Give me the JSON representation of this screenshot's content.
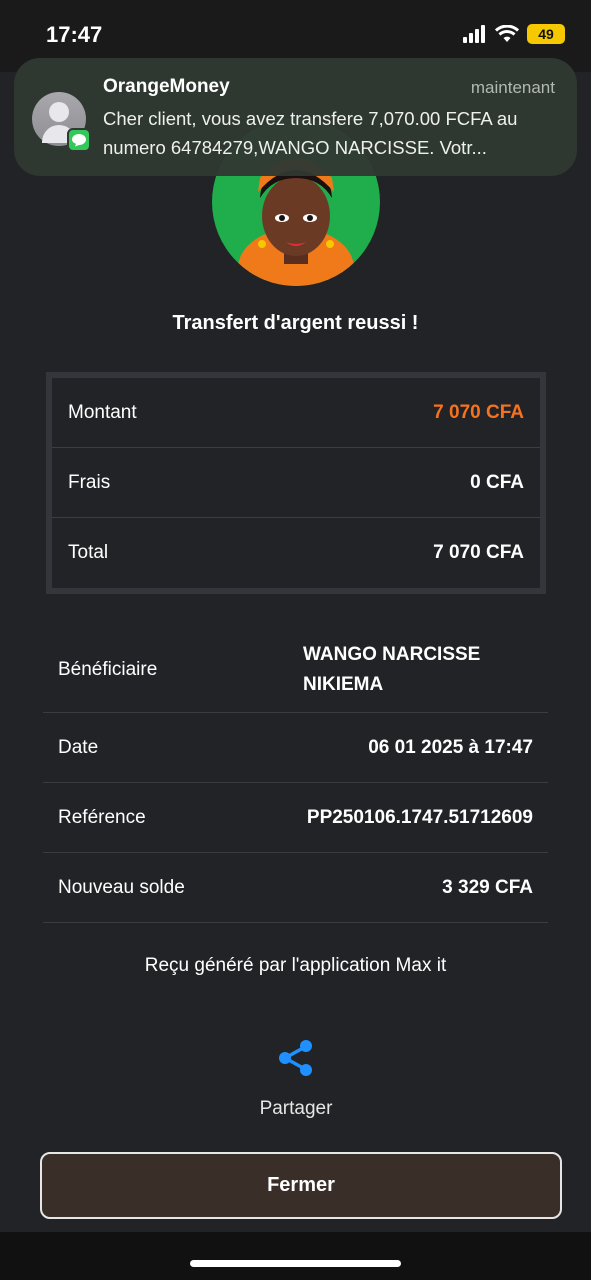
{
  "status": {
    "time": "17:47",
    "battery": "49"
  },
  "notification": {
    "app_name": "OrangeMoney",
    "time": "maintenant",
    "message": "Cher client, vous avez transfere 7,070.00 FCFA au numero 64784279,WANGO NARCISSE. Votr..."
  },
  "title": "Transfert d'argent reussi !",
  "summary": {
    "amount_label": "Montant",
    "amount_value": "7 070 CFA",
    "fees_label": "Frais",
    "fees_value": "0 CFA",
    "total_label": "Total",
    "total_value": "7 070 CFA",
    "accent_color": "#f5731e"
  },
  "details": {
    "beneficiary_label": "Bénéficiaire",
    "beneficiary_value": "WANGO NARCISSE NIKIEMA",
    "date_label": "Date",
    "date_value": "06 01 2025 à 17:47",
    "reference_label": "Reférence",
    "reference_value": "PP250106.1747.51712609",
    "balance_label": "Nouveau solde",
    "balance_value": "3 329 CFA"
  },
  "receipt_note": "Reçu généré par l'application Max it",
  "share_label": "Partager",
  "close_label": "Fermer",
  "icons": {
    "share": "share-icon",
    "message": "message-icon",
    "avatar": "avatar-illustration"
  }
}
